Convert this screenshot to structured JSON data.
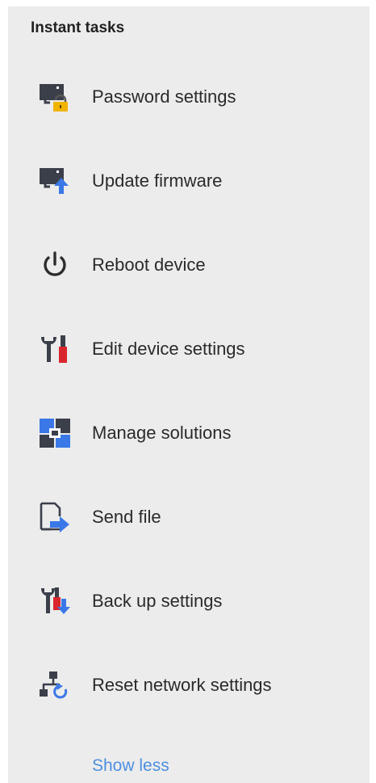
{
  "panel": {
    "title": "Instant tasks",
    "show_less_label": "Show less"
  },
  "tasks": [
    {
      "label": "Password settings",
      "icon": "password-lock-icon"
    },
    {
      "label": "Update firmware",
      "icon": "update-firmware-icon"
    },
    {
      "label": "Reboot device",
      "icon": "power-icon"
    },
    {
      "label": "Edit device settings",
      "icon": "tools-icon"
    },
    {
      "label": "Manage solutions",
      "icon": "solutions-icon"
    },
    {
      "label": "Send file",
      "icon": "send-file-icon"
    },
    {
      "label": "Back up settings",
      "icon": "backup-settings-icon"
    },
    {
      "label": "Reset network settings",
      "icon": "network-reset-icon"
    }
  ],
  "colors": {
    "panel_background": "#ececec",
    "link": "#4d8fe0",
    "accent_blue": "#3a78e7",
    "lock_yellow": "#f0b400",
    "tool_red": "#d9262c",
    "dark_icon": "#3b3f4a"
  }
}
